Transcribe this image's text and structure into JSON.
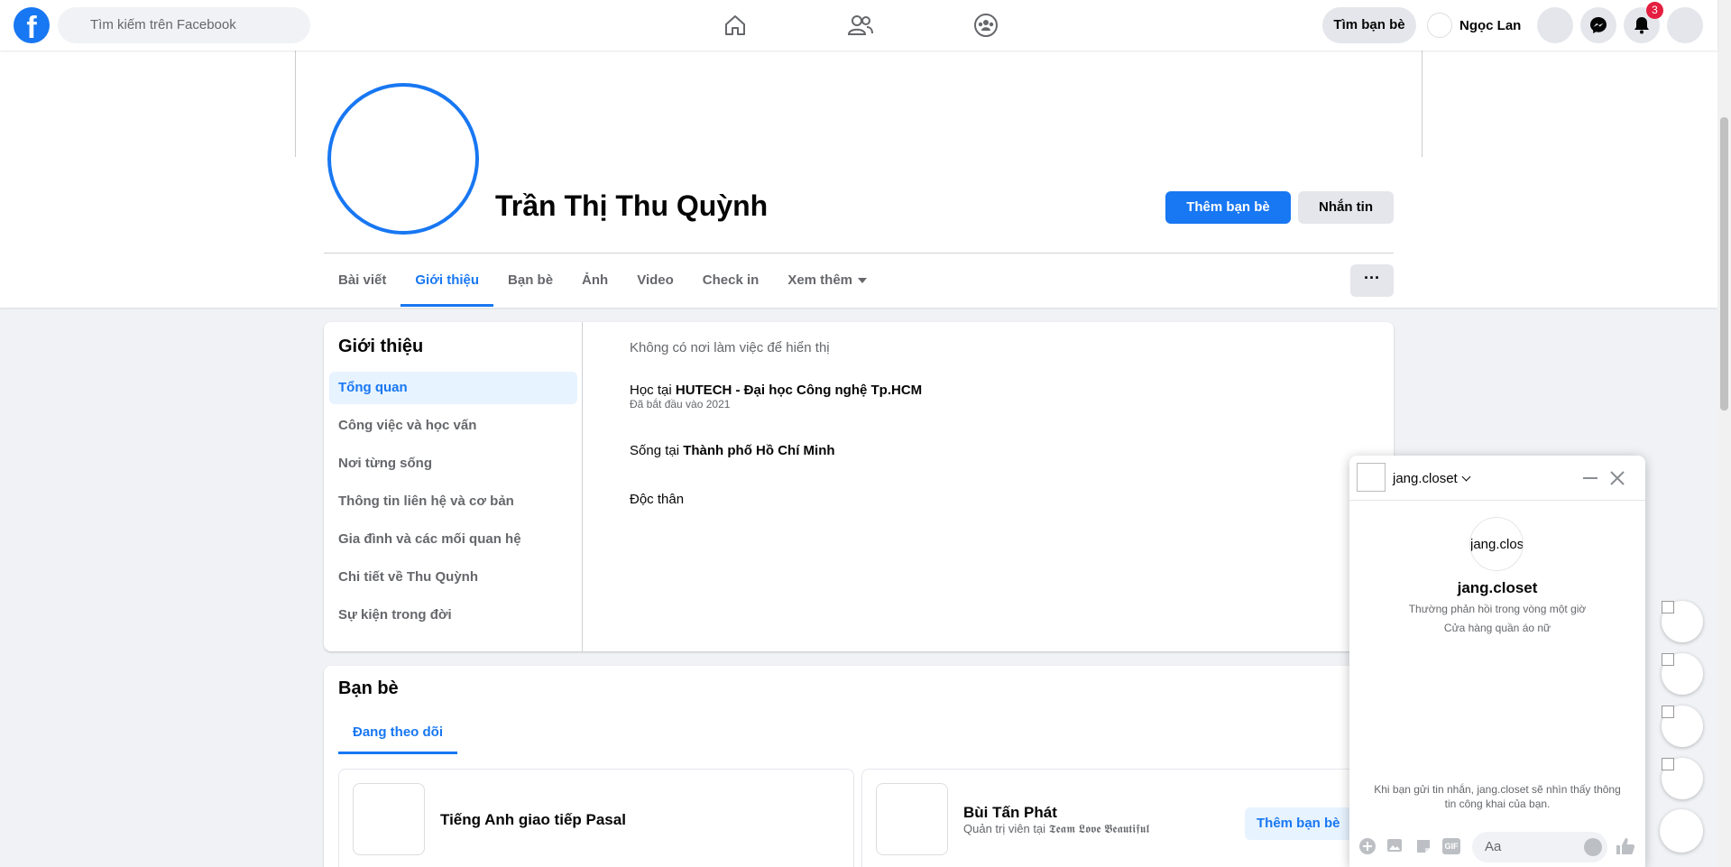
{
  "topbar": {
    "search_placeholder": "Tìm kiếm trên Facebook",
    "logo_letter": "f",
    "find_friends_label": "Tìm bạn bè",
    "user_name": "Ngọc Lan",
    "notification_count": "3",
    "accent_color": "#1877f2"
  },
  "profile": {
    "name": "Trần Thị Thu Quỳnh",
    "add_friend_label": "Thêm bạn bè",
    "message_label": "Nhắn tin",
    "more_label": "···",
    "tabs": [
      {
        "label": "Bài viết"
      },
      {
        "label": "Giới thiệu"
      },
      {
        "label": "Bạn bè"
      },
      {
        "label": "Ảnh"
      },
      {
        "label": "Video"
      },
      {
        "label": "Check in"
      },
      {
        "label": "Xem thêm"
      }
    ],
    "active_tab": "Giới thiệu"
  },
  "about": {
    "title": "Giới thiệu",
    "menu": [
      {
        "label": "Tổng quan"
      },
      {
        "label": "Công việc và học vấn"
      },
      {
        "label": "Nơi từng sống"
      },
      {
        "label": "Thông tin liên hệ và cơ bản"
      },
      {
        "label": "Gia đình và các mối quan hệ"
      },
      {
        "label": "Chi tiết về Thu Quỳnh"
      },
      {
        "label": "Sự kiện trong đời"
      }
    ],
    "no_work": "Không có nơi làm việc để hiển thị",
    "study_prefix": "Học tại ",
    "study_school": "HUTECH - Đại học Công nghệ Tp.HCM",
    "study_since": "Đã bắt đầu vào 2021",
    "live_prefix": "Sống tại ",
    "live_city": "Thành phố Hồ Chí Minh",
    "relationship": "Độc thân"
  },
  "friends": {
    "title": "Bạn bè",
    "tab_label": "Đang theo dõi",
    "cards": [
      {
        "name": "Tiếng Anh giao tiếp Pasal",
        "sub_prefix": "",
        "sub_name": "",
        "button": ""
      },
      {
        "name": "Bùi Tấn Phát",
        "sub_prefix": "Quản trị viên tại ",
        "sub_name": "𝕿𝖊𝖆𝖒 𝕷𝖔𝖛𝖊 𝕭𝖊𝖆𝖚𝖙𝖎𝖋𝖚𝖑",
        "button": "Thêm bạn bè"
      }
    ]
  },
  "chat": {
    "name": "jang.closet",
    "avatar_text": "jang.clos",
    "response_time": "Thường phản hồi trong vòng một giờ",
    "category": "Cửa hàng quần áo nữ",
    "notice": "Khi bạn gửi tin nhắn, jang.closet sẽ nhìn thấy thông tin công khai của bạn.",
    "input_placeholder": "Aa",
    "gif_label": "GIF"
  }
}
